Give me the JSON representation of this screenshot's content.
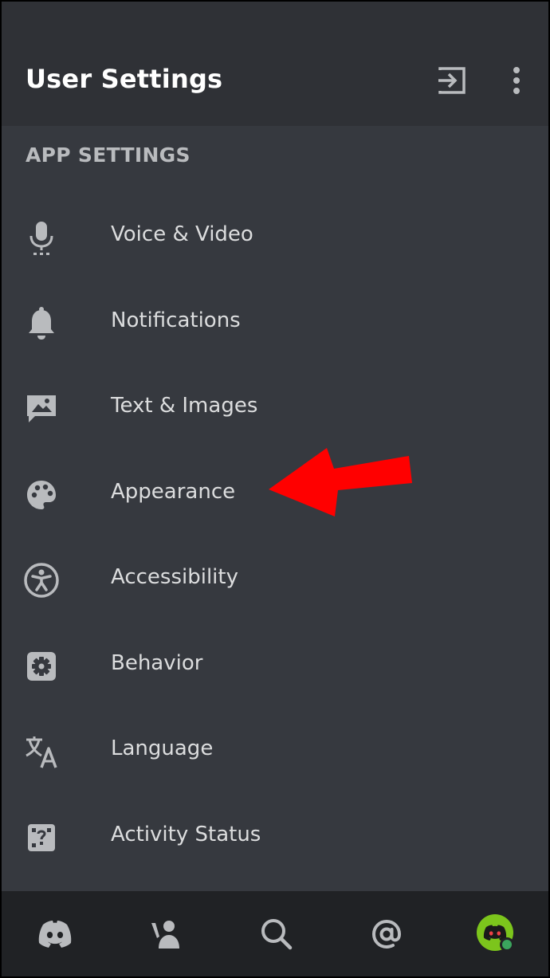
{
  "header": {
    "title": "User Settings",
    "actions": [
      {
        "icon": "logout-icon"
      },
      {
        "icon": "more-vertical-icon"
      }
    ]
  },
  "section": {
    "title": "APP SETTINGS"
  },
  "settings": {
    "items": [
      {
        "label": "Voice & Video",
        "icon": "microphone-icon"
      },
      {
        "label": "Notifications",
        "icon": "bell-icon"
      },
      {
        "label": "Text & Images",
        "icon": "image-icon"
      },
      {
        "label": "Appearance",
        "icon": "palette-icon"
      },
      {
        "label": "Accessibility",
        "icon": "accessibility-icon"
      },
      {
        "label": "Behavior",
        "icon": "gear-icon"
      },
      {
        "label": "Language",
        "icon": "translate-icon"
      },
      {
        "label": "Activity Status",
        "icon": "game-dice-icon"
      }
    ]
  },
  "annotation": {
    "arrow_color": "#ff0000",
    "points_to": "Appearance"
  },
  "bottom_nav": {
    "items": [
      {
        "icon": "discord-home-icon"
      },
      {
        "icon": "friends-icon"
      },
      {
        "icon": "search-icon"
      },
      {
        "icon": "mentions-icon"
      },
      {
        "icon": "user-avatar-icon",
        "status": "online"
      }
    ]
  },
  "colors": {
    "background": "#36393f",
    "header_background": "#2f3136",
    "nav_background": "#202225",
    "text_primary": "#ffffff",
    "text_label": "#dcddde",
    "text_muted": "#b9bbbe",
    "icon": "#b9bbbe",
    "avatar_background": "#7cc51c",
    "online_status": "#3ba55d"
  }
}
